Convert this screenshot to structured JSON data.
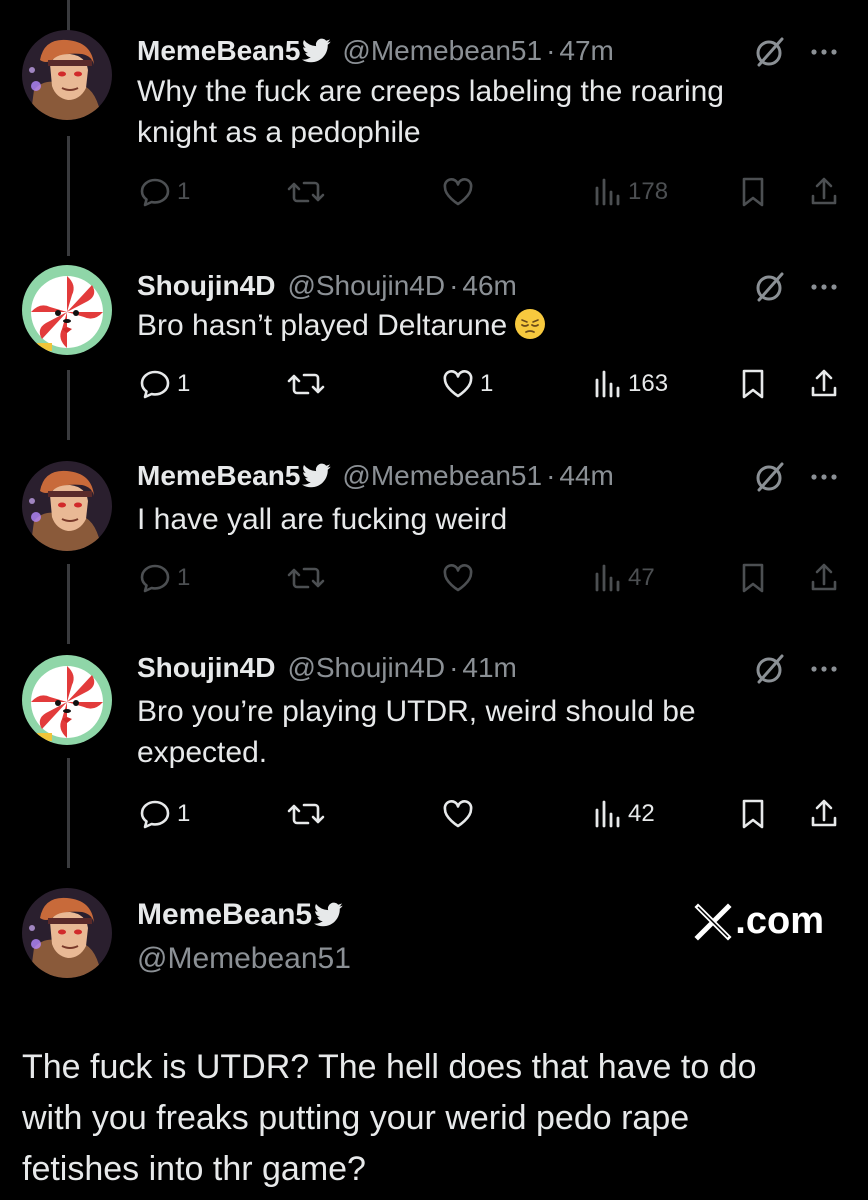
{
  "icons": {
    "verified": "verified-badge-icon",
    "grok": "grok-slash-icon",
    "more": "more-dots-icon",
    "reply": "reply-bubble-icon",
    "retweet": "retweet-icon",
    "like": "heart-icon",
    "views": "views-bars-icon",
    "bookmark": "bookmark-icon",
    "share": "share-icon"
  },
  "colors": {
    "background": "#000000",
    "text": "#e7e9ea",
    "muted": "#8b9095",
    "thread_line": "#3a3b3e"
  },
  "tweets": [
    {
      "name": "MemeBean5",
      "handle": "@Memebean51",
      "separator": "·",
      "time": "47m",
      "lines": [
        "Why the fuck are creeps labeling the roaring",
        "knight as a pedophile"
      ],
      "reply_count": "1",
      "like_count": "",
      "views": "178"
    },
    {
      "name": "Shoujin4D",
      "handle": "@Shoujin4D",
      "separator": "·",
      "time": "46m",
      "lines": [
        "Bro hasn’t played Deltarune"
      ],
      "emoji": "pensive-face-emoji",
      "reply_count": "1",
      "like_count": "1",
      "views": "163"
    },
    {
      "name": "MemeBean5",
      "handle": "@Memebean51",
      "separator": "·",
      "time": "44m",
      "lines": [
        "I have yall are fucking weird"
      ],
      "reply_count": "1",
      "like_count": "",
      "views": "47"
    },
    {
      "name": "Shoujin4D",
      "handle": "@Shoujin4D",
      "separator": "·",
      "time": "41m",
      "lines": [
        "Bro you’re playing UTDR, weird should be",
        "expected."
      ],
      "reply_count": "1",
      "like_count": "",
      "views": "42"
    }
  ],
  "quote": {
    "name": "MemeBean5",
    "handle": "@Memebean51",
    "brand": ".com",
    "lines": [
      "The fuck is UTDR? The hell does that have to do",
      "with you freaks putting your werid pedo rape",
      "fetishes into thr game?"
    ]
  }
}
